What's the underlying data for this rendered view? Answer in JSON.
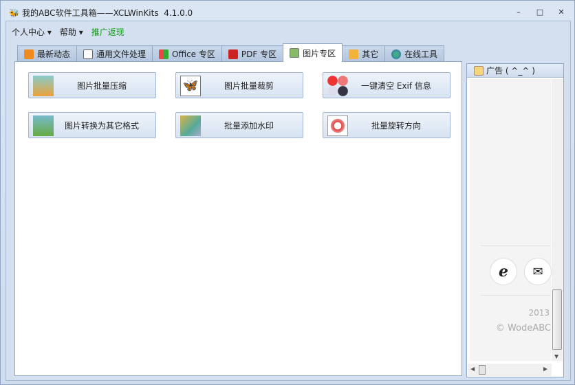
{
  "window": {
    "title": "我的ABC软件工具箱——XCLWinKits  4.1.0.0",
    "minimize": "–",
    "maximize": "□",
    "close": "✕"
  },
  "menu": {
    "items": [
      "个人中心",
      "帮助"
    ],
    "promo": "推广返现",
    "promo_color": "#0a9a0a"
  },
  "tabs": [
    {
      "label": "最新动态",
      "icon": "rss-icon"
    },
    {
      "label": "通用文件处理",
      "icon": "document-icon"
    },
    {
      "label": "Office 专区",
      "icon": "office-icon"
    },
    {
      "label": "PDF 专区",
      "icon": "pdf-icon"
    },
    {
      "label": "图片专区",
      "icon": "image-icon",
      "active": true
    },
    {
      "label": "其它",
      "icon": "folder-icon"
    },
    {
      "label": "在线工具",
      "icon": "globe-icon"
    }
  ],
  "buttons": [
    {
      "label": "图片批量压缩",
      "icon": "image-compress-icon"
    },
    {
      "label": "图片批量裁剪",
      "icon": "crop-icon"
    },
    {
      "label": "一键清空 Exif 信息",
      "icon": "exif-clear-icon"
    },
    {
      "label": "图片转换为其它格式",
      "icon": "image-convert-icon"
    },
    {
      "label": "批量添加水印",
      "icon": "watermark-icon"
    },
    {
      "label": "批量旋转方向",
      "icon": "rotate-icon"
    }
  ],
  "sidebar": {
    "title": "广告 ( ^_^ )",
    "year": "2013",
    "copyright": "© WodeABC"
  }
}
